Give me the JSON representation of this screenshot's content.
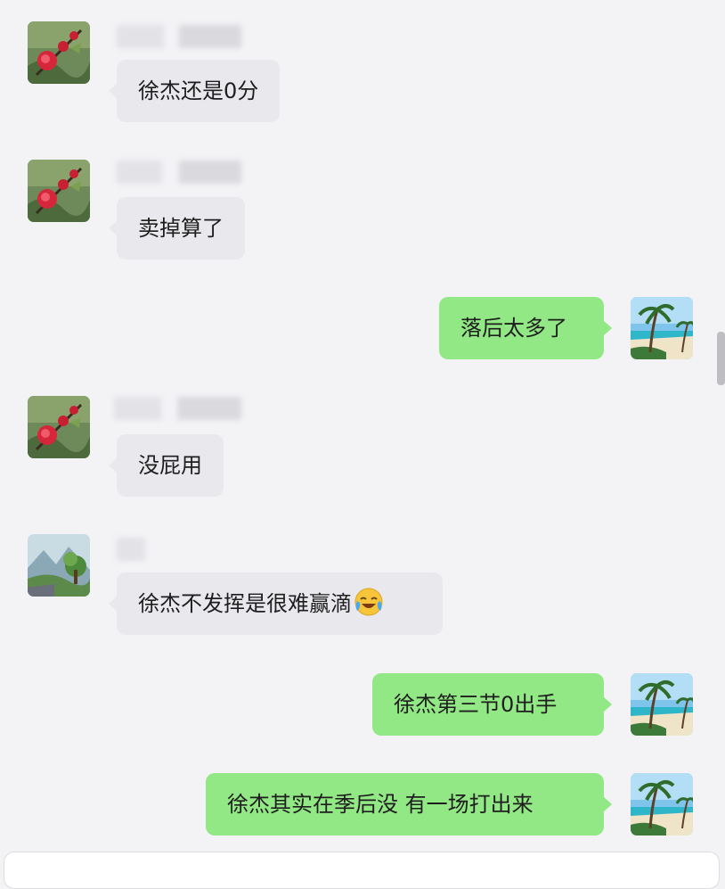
{
  "messages": [
    {
      "side": "left",
      "avatar": "red-flower-avatar",
      "text": "徐杰还是0分"
    },
    {
      "side": "left",
      "avatar": "red-flower-avatar",
      "text": "卖掉算了"
    },
    {
      "side": "right",
      "avatar": "beach-palm-avatar",
      "text": "落后太多了"
    },
    {
      "side": "left",
      "avatar": "red-flower-avatar",
      "text": "没屁用"
    },
    {
      "side": "left",
      "avatar": "landscape-avatar",
      "text": "徐杰不发挥是很难赢滴",
      "emoji": "crying-laughing-emoji"
    },
    {
      "side": "right",
      "avatar": "beach-palm-avatar",
      "text": "徐杰第三节0出手"
    },
    {
      "side": "right",
      "avatar": "beach-palm-avatar",
      "text": "徐杰其实在季后没 有一场打出来"
    }
  ],
  "colors": {
    "background": "#f3f3f6",
    "incoming_bubble": "#e8e8ed",
    "outgoing_bubble": "#92e884"
  }
}
